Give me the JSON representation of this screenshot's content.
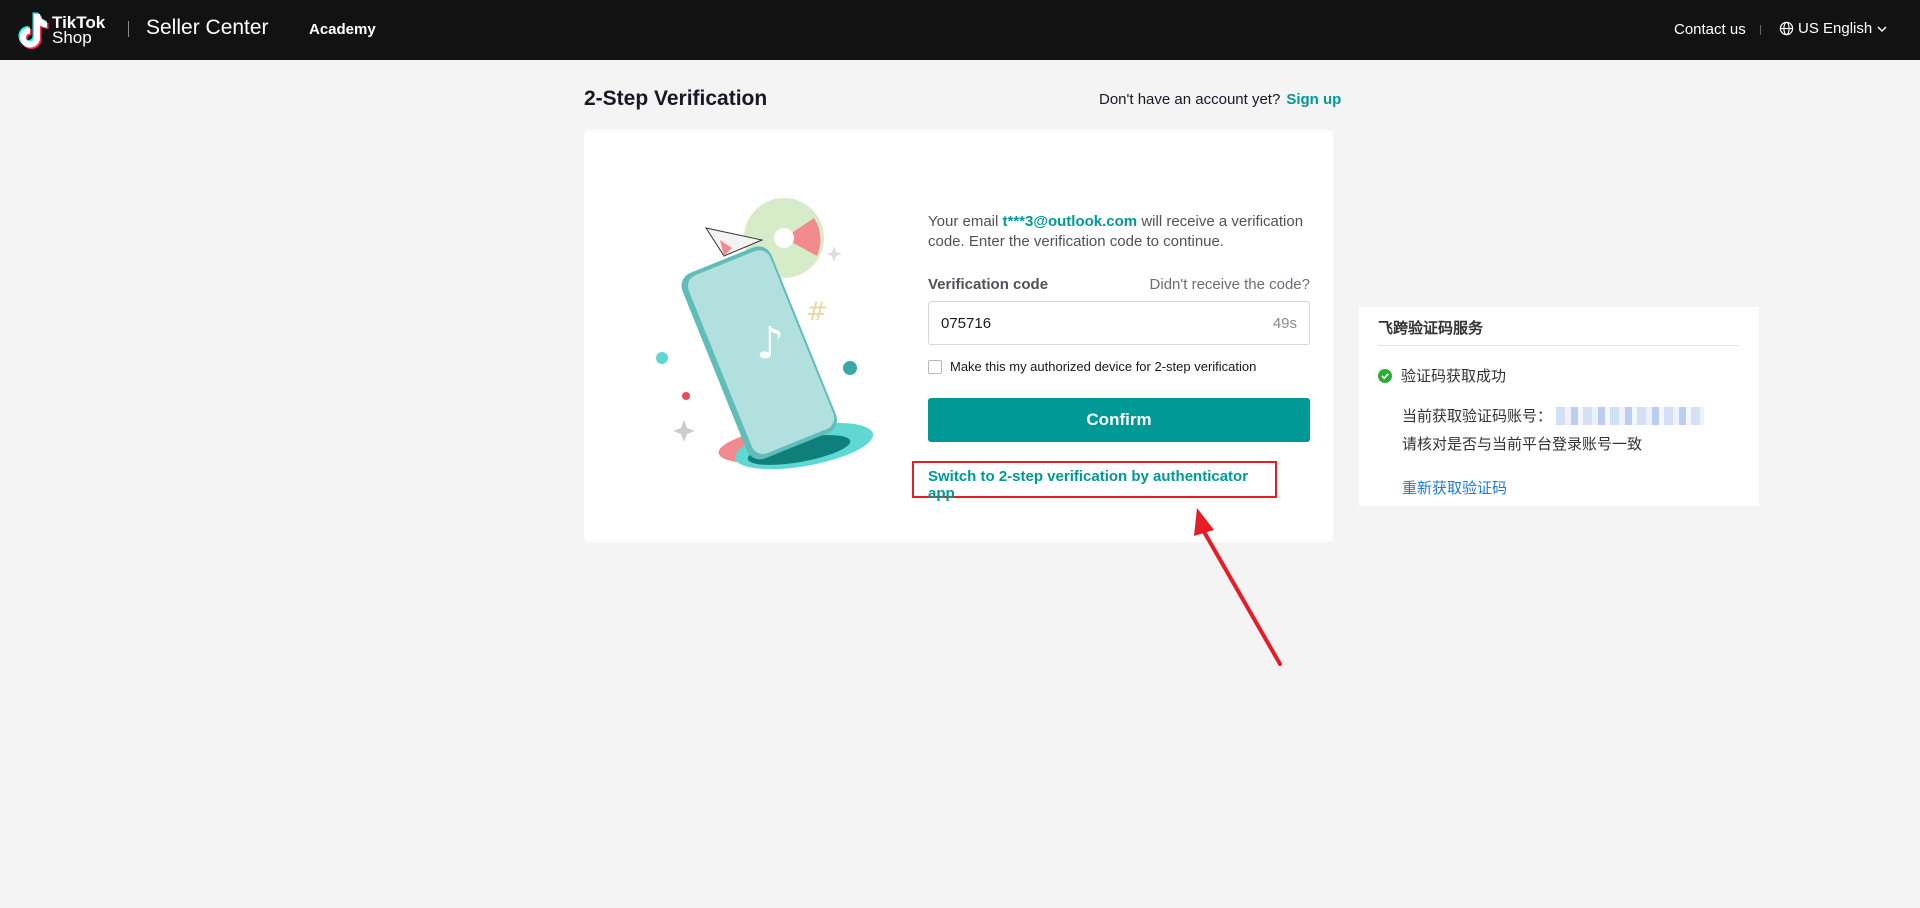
{
  "header": {
    "logo_line1": "TikTok",
    "logo_line2": "Shop",
    "product_name": "Seller Center",
    "nav_academy": "Academy",
    "contact": "Contact us",
    "language": "US English"
  },
  "page": {
    "title": "2-Step Verification",
    "no_account": "Don't have an account yet?",
    "sign_up": "Sign up"
  },
  "form": {
    "desc_prefix": "Your email ",
    "email": "t***3@outlook.com",
    "desc_suffix": " will receive a verification code. Enter the verification code to continue.",
    "code_label": "Verification code",
    "resend": "Didn't receive the code?",
    "code_value": "075716",
    "countdown": "49s",
    "remember_label": "Make this my authorized device for 2-step verification",
    "confirm": "Confirm",
    "switch_link": "Switch to 2-step verification by authenticator app"
  },
  "side_panel": {
    "title": "飞跨验证码服务",
    "status": "验证码获取成功",
    "account_label": "当前获取验证码账号：",
    "hint": "请核对是否与当前平台登录账号一致",
    "refetch": "重新获取验证码"
  },
  "colors": {
    "brand": "#009995",
    "topbar": "#121212",
    "annotation": "#e41d27"
  },
  "icons": [
    "tiktok-logo-icon",
    "globe-icon",
    "chevron-down-icon",
    "check-circle-icon"
  ]
}
